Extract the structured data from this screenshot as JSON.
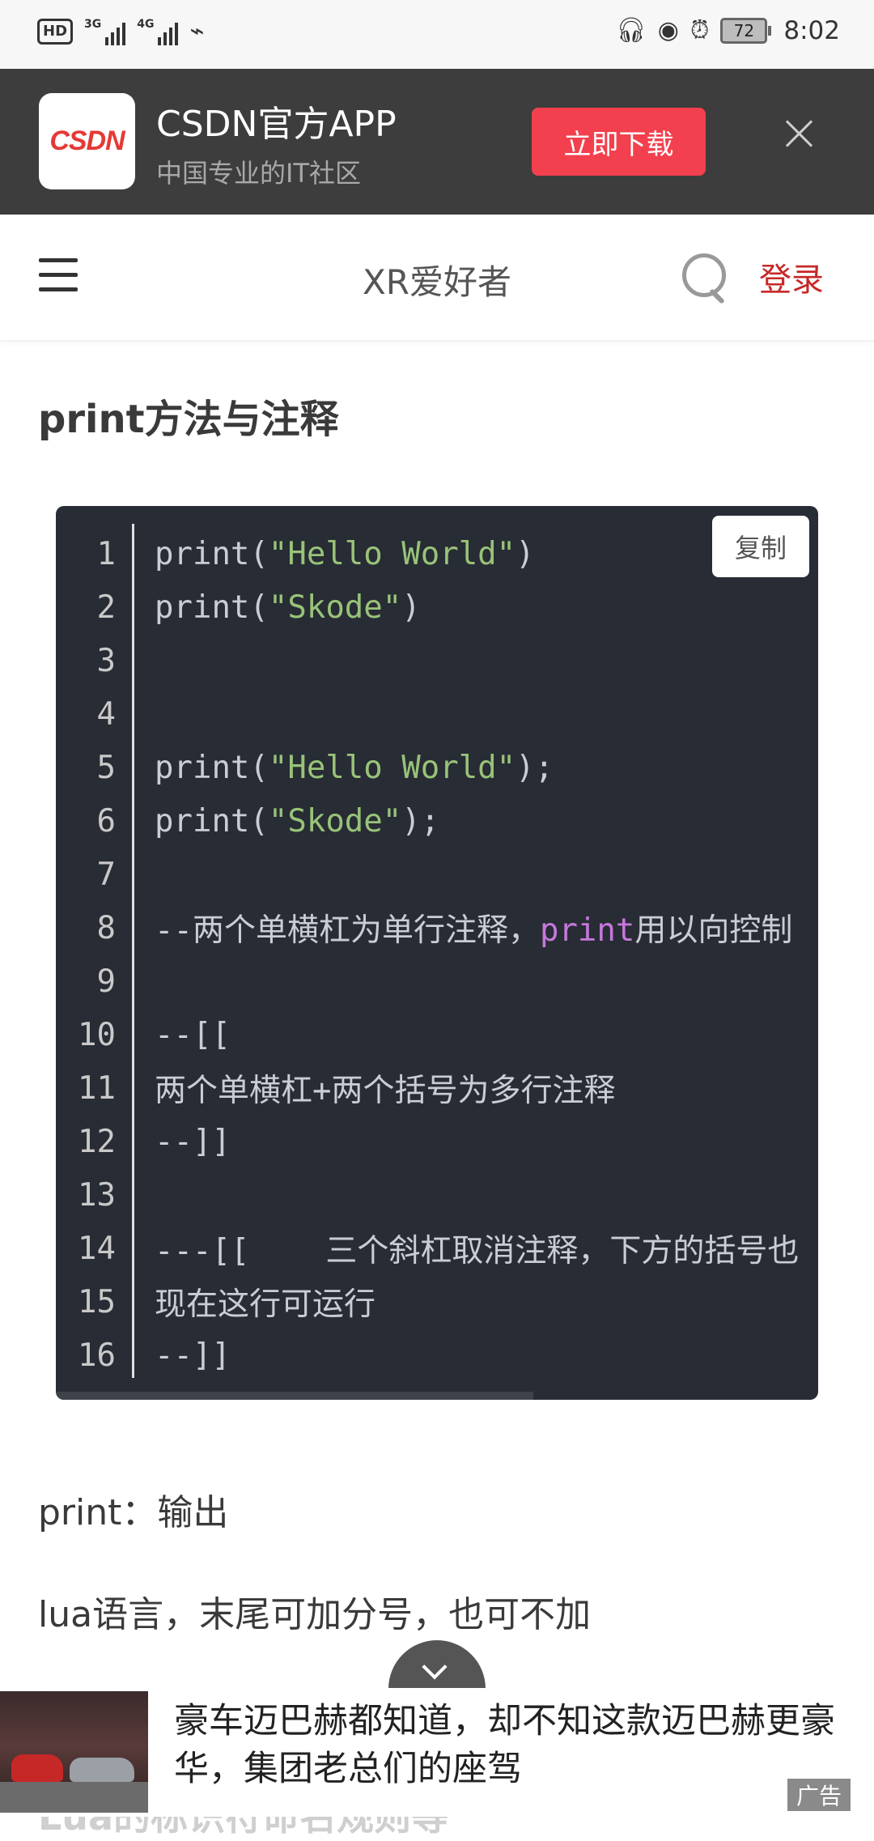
{
  "status_bar": {
    "hd": "HD",
    "net1": "3G",
    "net2": "4G",
    "battery": "72",
    "time": "8:02",
    "icons": [
      "headset-icon",
      "eye-icon",
      "alarm-icon"
    ]
  },
  "app_banner": {
    "logo_text": "CSDN",
    "name": "CSDN官方APP",
    "subtitle": "中国专业的IT社区",
    "download_label": "立即下载"
  },
  "nav": {
    "title": "XR爱好者",
    "login_label": "登录"
  },
  "article": {
    "title": "print方法与注释",
    "copy_label": "复制",
    "code_lines": [
      {
        "n": "1",
        "text": "print(\"Hello World\")"
      },
      {
        "n": "2",
        "text": "print(\"Skode\")"
      },
      {
        "n": "3",
        "text": ""
      },
      {
        "n": "4",
        "text": ""
      },
      {
        "n": "5",
        "text": "print(\"Hello World\");"
      },
      {
        "n": "6",
        "text": "print(\"Skode\");"
      },
      {
        "n": "7",
        "text": ""
      },
      {
        "n": "8",
        "text": "--两个单横杠为单行注释，print用以向控制"
      },
      {
        "n": "9",
        "text": ""
      },
      {
        "n": "10",
        "text": "--[["
      },
      {
        "n": "11",
        "text": "两个单横杠+两个括号为多行注释"
      },
      {
        "n": "12",
        "text": "--]]"
      },
      {
        "n": "13",
        "text": ""
      },
      {
        "n": "14",
        "text": "---[[    三个斜杠取消注释，下方的括号也"
      },
      {
        "n": "15",
        "text": "现在这行可运行"
      },
      {
        "n": "16",
        "text": "--]]"
      }
    ],
    "para1": "print：输出",
    "para2": "lua语言，末尾可加分号，也可不加",
    "cut_heading": "Lua的标识符命名规则等"
  },
  "ad": {
    "text": "豪车迈巴赫都知道，却不知这款迈巴赫更豪华，集团老总们的座驾",
    "tag": "广告"
  },
  "colors": {
    "banner_bg": "#3d3d3d",
    "download_btn": "#f3404e",
    "code_bg": "#282c34",
    "string": "#98c379",
    "keyword": "#c678dd",
    "login": "#c62828"
  }
}
